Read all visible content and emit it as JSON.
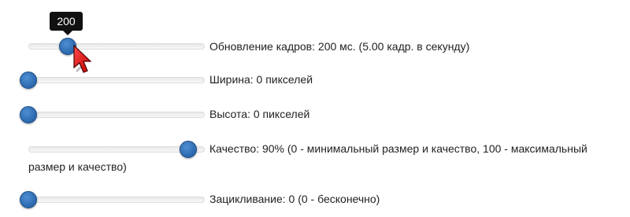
{
  "sliders": {
    "frames": {
      "value": 200,
      "tooltip": "200",
      "label": "Обновление кадров: 200 мс. (5.00 кадр. в секунду)"
    },
    "width": {
      "value": 0,
      "label": "Ширина: 0 пикселей"
    },
    "height": {
      "value": 0,
      "label": "Высота: 0 пикселей"
    },
    "quality": {
      "value": 90,
      "label_line1": "Качество: 90% (0 - минимальный размер и качество, 100 - максимальный",
      "label_line2": "размер и качество)"
    },
    "loop": {
      "value": 0,
      "label": "Зацикливание: 0 (0 - бесконечно)"
    }
  },
  "colors": {
    "handle": "#2a67ad",
    "tooltip_bg": "#111111",
    "cursor": "#e02020"
  },
  "icons": {
    "cursor": "mouse-pointer-icon"
  }
}
